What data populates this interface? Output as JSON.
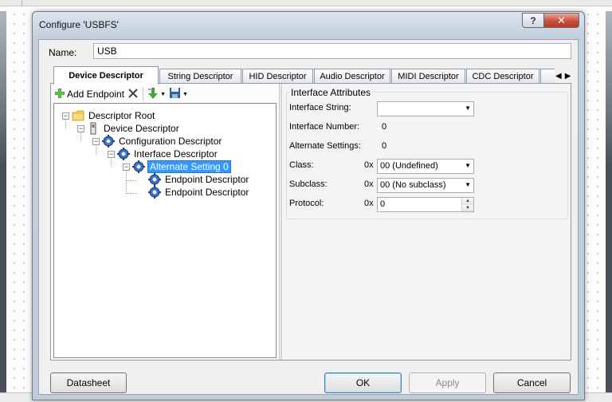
{
  "window": {
    "title": "Configure 'USBFS'",
    "help_glyph": "?",
    "close_glyph": "✕"
  },
  "name_row": {
    "label": "Name:",
    "value": "USB"
  },
  "tabs": [
    {
      "label": "Device Descriptor",
      "active": true
    },
    {
      "label": "String Descriptor"
    },
    {
      "label": "HID Descriptor"
    },
    {
      "label": "Audio Descriptor"
    },
    {
      "label": "MIDI Descriptor"
    },
    {
      "label": "CDC Descriptor"
    }
  ],
  "toolbar": {
    "add_endpoint": "Add Endpoint"
  },
  "tree": {
    "nodes": [
      {
        "label": "Descriptor Root",
        "icon": "folder-icon"
      },
      {
        "label": "Device Descriptor",
        "icon": "device-icon"
      },
      {
        "label": "Configuration Descriptor",
        "icon": "gear-icon"
      },
      {
        "label": "Interface Descriptor",
        "icon": "gear-icon"
      },
      {
        "label": "Alternate Setting 0",
        "icon": "gear-icon",
        "selected": true
      },
      {
        "label": "Endpoint Descriptor",
        "icon": "gear-icon"
      },
      {
        "label": "Endpoint Descriptor",
        "icon": "gear-icon"
      }
    ]
  },
  "interface": {
    "group_title": "Interface Attributes",
    "interface_string": {
      "label": "Interface String:",
      "value": ""
    },
    "interface_number": {
      "label": "Interface Number:",
      "value": "0"
    },
    "alternate_settings": {
      "label": "Alternate Settings:",
      "value": "0"
    },
    "class": {
      "label": "Class:",
      "prefix": "0x",
      "value": "00 (Undefined)"
    },
    "subclass": {
      "label": "Subclass:",
      "prefix": "0x",
      "value": "00 (No subclass)"
    },
    "protocol": {
      "label": "Protocol:",
      "prefix": "0x",
      "value": "0"
    }
  },
  "buttons": {
    "datasheet": "Datasheet",
    "ok": "OK",
    "apply": "Apply",
    "cancel": "Cancel"
  }
}
